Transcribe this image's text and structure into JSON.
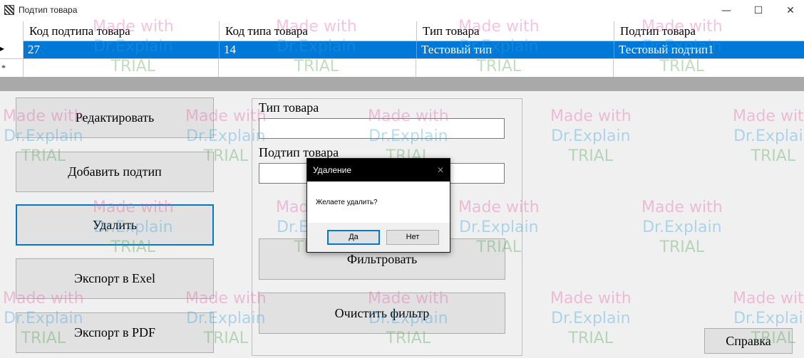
{
  "window": {
    "title": "Подтип товара",
    "controls": {
      "minimize": "—",
      "maximize": "☐",
      "close": "✕"
    }
  },
  "grid": {
    "columns": [
      "Код подтипа товара",
      "Код типа товара",
      "Тип товара",
      "Подтип товара"
    ],
    "rows": [
      {
        "cells": [
          "27",
          "14",
          "Тестовый тип",
          "Тестовый подтип1"
        ],
        "selected": true
      }
    ],
    "row_indicators": {
      "current": "▸",
      "new": "*"
    }
  },
  "buttons": {
    "edit": "Редактировать",
    "add_subtype": "Добавить подтип",
    "delete": "Удалить",
    "export_excel": "Экспорт в Exel",
    "export_pdf": "Экспорт в PDF",
    "help": "Справка"
  },
  "filter": {
    "type_label": "Тип товара",
    "type_value": "",
    "subtype_label": "Подтип товара",
    "subtype_value": "",
    "filter_button": "Фильтровать",
    "clear_button": "Очистить фильтр"
  },
  "dialog": {
    "title": "Удаление",
    "close": "✕",
    "message": "Желаете удалить?",
    "yes": "Да",
    "no": "Нет"
  },
  "watermark": {
    "line1": "Made with",
    "line2": "Dr.Explain",
    "line3": "TRIAL"
  },
  "colors": {
    "selection": "#0078d7",
    "focus_border": "#0078d7",
    "grid_bottom": "#a9a9a9",
    "dialog_title_bar": "#000000"
  }
}
